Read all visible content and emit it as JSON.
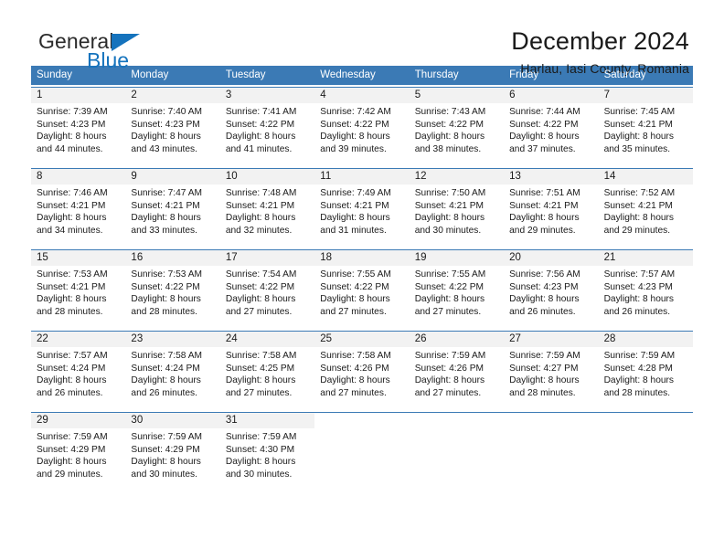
{
  "brand": {
    "word_one": "General",
    "word_two": "Blue",
    "accent_color": "#1573bd",
    "triangle_icon": "triangle-icon"
  },
  "header": {
    "title": "December 2024",
    "subtitle": "Harlau, Iasi County, Romania"
  },
  "calendar": {
    "header_bg": "#3b7ab5",
    "daynum_bg": "#f2f2f2",
    "weekdays": [
      "Sunday",
      "Monday",
      "Tuesday",
      "Wednesday",
      "Thursday",
      "Friday",
      "Saturday"
    ],
    "weeks": [
      [
        {
          "day": "1",
          "sunrise": "Sunrise: 7:39 AM",
          "sunset": "Sunset: 4:23 PM",
          "daylight_1": "Daylight: 8 hours",
          "daylight_2": "and 44 minutes."
        },
        {
          "day": "2",
          "sunrise": "Sunrise: 7:40 AM",
          "sunset": "Sunset: 4:23 PM",
          "daylight_1": "Daylight: 8 hours",
          "daylight_2": "and 43 minutes."
        },
        {
          "day": "3",
          "sunrise": "Sunrise: 7:41 AM",
          "sunset": "Sunset: 4:22 PM",
          "daylight_1": "Daylight: 8 hours",
          "daylight_2": "and 41 minutes."
        },
        {
          "day": "4",
          "sunrise": "Sunrise: 7:42 AM",
          "sunset": "Sunset: 4:22 PM",
          "daylight_1": "Daylight: 8 hours",
          "daylight_2": "and 39 minutes."
        },
        {
          "day": "5",
          "sunrise": "Sunrise: 7:43 AM",
          "sunset": "Sunset: 4:22 PM",
          "daylight_1": "Daylight: 8 hours",
          "daylight_2": "and 38 minutes."
        },
        {
          "day": "6",
          "sunrise": "Sunrise: 7:44 AM",
          "sunset": "Sunset: 4:22 PM",
          "daylight_1": "Daylight: 8 hours",
          "daylight_2": "and 37 minutes."
        },
        {
          "day": "7",
          "sunrise": "Sunrise: 7:45 AM",
          "sunset": "Sunset: 4:21 PM",
          "daylight_1": "Daylight: 8 hours",
          "daylight_2": "and 35 minutes."
        }
      ],
      [
        {
          "day": "8",
          "sunrise": "Sunrise: 7:46 AM",
          "sunset": "Sunset: 4:21 PM",
          "daylight_1": "Daylight: 8 hours",
          "daylight_2": "and 34 minutes."
        },
        {
          "day": "9",
          "sunrise": "Sunrise: 7:47 AM",
          "sunset": "Sunset: 4:21 PM",
          "daylight_1": "Daylight: 8 hours",
          "daylight_2": "and 33 minutes."
        },
        {
          "day": "10",
          "sunrise": "Sunrise: 7:48 AM",
          "sunset": "Sunset: 4:21 PM",
          "daylight_1": "Daylight: 8 hours",
          "daylight_2": "and 32 minutes."
        },
        {
          "day": "11",
          "sunrise": "Sunrise: 7:49 AM",
          "sunset": "Sunset: 4:21 PM",
          "daylight_1": "Daylight: 8 hours",
          "daylight_2": "and 31 minutes."
        },
        {
          "day": "12",
          "sunrise": "Sunrise: 7:50 AM",
          "sunset": "Sunset: 4:21 PM",
          "daylight_1": "Daylight: 8 hours",
          "daylight_2": "and 30 minutes."
        },
        {
          "day": "13",
          "sunrise": "Sunrise: 7:51 AM",
          "sunset": "Sunset: 4:21 PM",
          "daylight_1": "Daylight: 8 hours",
          "daylight_2": "and 29 minutes."
        },
        {
          "day": "14",
          "sunrise": "Sunrise: 7:52 AM",
          "sunset": "Sunset: 4:21 PM",
          "daylight_1": "Daylight: 8 hours",
          "daylight_2": "and 29 minutes."
        }
      ],
      [
        {
          "day": "15",
          "sunrise": "Sunrise: 7:53 AM",
          "sunset": "Sunset: 4:21 PM",
          "daylight_1": "Daylight: 8 hours",
          "daylight_2": "and 28 minutes."
        },
        {
          "day": "16",
          "sunrise": "Sunrise: 7:53 AM",
          "sunset": "Sunset: 4:22 PM",
          "daylight_1": "Daylight: 8 hours",
          "daylight_2": "and 28 minutes."
        },
        {
          "day": "17",
          "sunrise": "Sunrise: 7:54 AM",
          "sunset": "Sunset: 4:22 PM",
          "daylight_1": "Daylight: 8 hours",
          "daylight_2": "and 27 minutes."
        },
        {
          "day": "18",
          "sunrise": "Sunrise: 7:55 AM",
          "sunset": "Sunset: 4:22 PM",
          "daylight_1": "Daylight: 8 hours",
          "daylight_2": "and 27 minutes."
        },
        {
          "day": "19",
          "sunrise": "Sunrise: 7:55 AM",
          "sunset": "Sunset: 4:22 PM",
          "daylight_1": "Daylight: 8 hours",
          "daylight_2": "and 27 minutes."
        },
        {
          "day": "20",
          "sunrise": "Sunrise: 7:56 AM",
          "sunset": "Sunset: 4:23 PM",
          "daylight_1": "Daylight: 8 hours",
          "daylight_2": "and 26 minutes."
        },
        {
          "day": "21",
          "sunrise": "Sunrise: 7:57 AM",
          "sunset": "Sunset: 4:23 PM",
          "daylight_1": "Daylight: 8 hours",
          "daylight_2": "and 26 minutes."
        }
      ],
      [
        {
          "day": "22",
          "sunrise": "Sunrise: 7:57 AM",
          "sunset": "Sunset: 4:24 PM",
          "daylight_1": "Daylight: 8 hours",
          "daylight_2": "and 26 minutes."
        },
        {
          "day": "23",
          "sunrise": "Sunrise: 7:58 AM",
          "sunset": "Sunset: 4:24 PM",
          "daylight_1": "Daylight: 8 hours",
          "daylight_2": "and 26 minutes."
        },
        {
          "day": "24",
          "sunrise": "Sunrise: 7:58 AM",
          "sunset": "Sunset: 4:25 PM",
          "daylight_1": "Daylight: 8 hours",
          "daylight_2": "and 27 minutes."
        },
        {
          "day": "25",
          "sunrise": "Sunrise: 7:58 AM",
          "sunset": "Sunset: 4:26 PM",
          "daylight_1": "Daylight: 8 hours",
          "daylight_2": "and 27 minutes."
        },
        {
          "day": "26",
          "sunrise": "Sunrise: 7:59 AM",
          "sunset": "Sunset: 4:26 PM",
          "daylight_1": "Daylight: 8 hours",
          "daylight_2": "and 27 minutes."
        },
        {
          "day": "27",
          "sunrise": "Sunrise: 7:59 AM",
          "sunset": "Sunset: 4:27 PM",
          "daylight_1": "Daylight: 8 hours",
          "daylight_2": "and 28 minutes."
        },
        {
          "day": "28",
          "sunrise": "Sunrise: 7:59 AM",
          "sunset": "Sunset: 4:28 PM",
          "daylight_1": "Daylight: 8 hours",
          "daylight_2": "and 28 minutes."
        }
      ],
      [
        {
          "day": "29",
          "sunrise": "Sunrise: 7:59 AM",
          "sunset": "Sunset: 4:29 PM",
          "daylight_1": "Daylight: 8 hours",
          "daylight_2": "and 29 minutes."
        },
        {
          "day": "30",
          "sunrise": "Sunrise: 7:59 AM",
          "sunset": "Sunset: 4:29 PM",
          "daylight_1": "Daylight: 8 hours",
          "daylight_2": "and 30 minutes."
        },
        {
          "day": "31",
          "sunrise": "Sunrise: 7:59 AM",
          "sunset": "Sunset: 4:30 PM",
          "daylight_1": "Daylight: 8 hours",
          "daylight_2": "and 30 minutes."
        },
        {
          "day": "",
          "sunrise": "",
          "sunset": "",
          "daylight_1": "",
          "daylight_2": ""
        },
        {
          "day": "",
          "sunrise": "",
          "sunset": "",
          "daylight_1": "",
          "daylight_2": ""
        },
        {
          "day": "",
          "sunrise": "",
          "sunset": "",
          "daylight_1": "",
          "daylight_2": ""
        },
        {
          "day": "",
          "sunrise": "",
          "sunset": "",
          "daylight_1": "",
          "daylight_2": ""
        }
      ]
    ]
  }
}
